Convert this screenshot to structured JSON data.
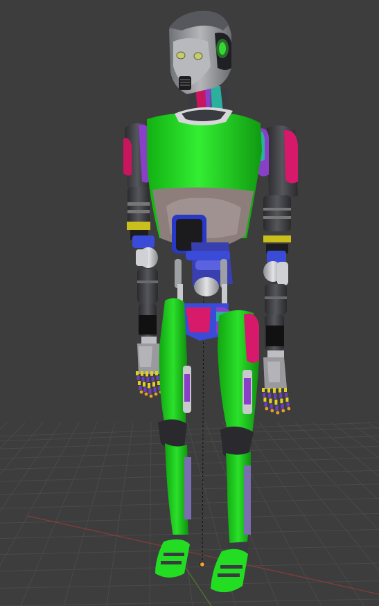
{
  "viewport": {
    "background_color": "#3d3d3d",
    "grid_color": "#4a4a4a",
    "x_axis_color": "#8a3b3b",
    "y_axis_color": "#4f7a2e",
    "origin_color": "#f0a030"
  },
  "model": {
    "body_green": "#22dd22",
    "head_gray": "#9a9ca0",
    "limb_dark": "#3a3a3e",
    "accent_magenta": "#d6196a",
    "accent_purple": "#8a3fc8",
    "accent_blue": "#3a4bd8",
    "accent_yellow": "#e0d020"
  }
}
